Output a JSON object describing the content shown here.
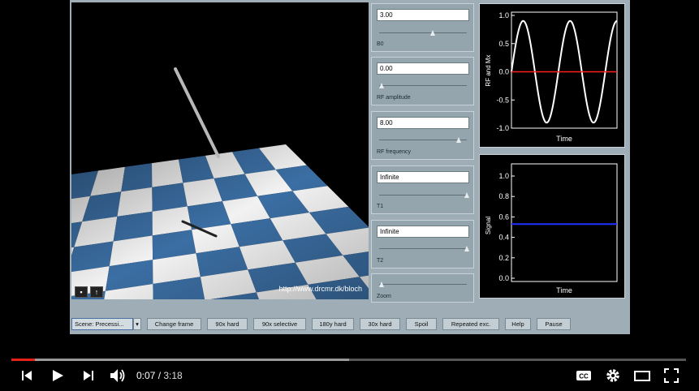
{
  "controls": [
    {
      "value": "3.00",
      "label": "B0",
      "thumb": 0.6
    },
    {
      "value": "0.00",
      "label": "RF amplitude",
      "thumb": 0.0
    },
    {
      "value": "8.00",
      "label": "RF frequency",
      "thumb": 0.9
    },
    {
      "value": "Infinite",
      "label": "T1",
      "thumb": 1.0
    },
    {
      "value": "Infinite",
      "label": "T2",
      "thumb": 1.0
    }
  ],
  "zoom": {
    "label": "Zoom",
    "thumb": 0.0
  },
  "viewport": {
    "url": "http://www.drcmr.dk/bloch"
  },
  "plot_rf": {
    "ylabel": "RF and Mx",
    "xlabel": "Time",
    "yticks": [
      "1.0",
      "0.5",
      "0.0",
      "-0.5",
      "-1.0"
    ],
    "colors": {
      "mx": "#ffffff",
      "rf": "#ff2020"
    }
  },
  "plot_signal": {
    "ylabel": "Signal",
    "xlabel": "Time",
    "yticks": [
      "1.0",
      "0.8",
      "0.6",
      "0.4",
      "0.2",
      "0.0"
    ],
    "signal_level": 0.53,
    "colors": {
      "signal": "#2030ff"
    }
  },
  "toolbar": {
    "scene_select": "Scene: Precessi...",
    "buttons": [
      "Change frame",
      "90x hard",
      "90x selective",
      "180y hard",
      "30x hard",
      "Spoil",
      "Repeated exc.",
      "Help",
      "Pause"
    ]
  },
  "player": {
    "current_time": "0:07",
    "duration": "3:18",
    "progress": 0.035,
    "buffered": 0.5
  }
}
